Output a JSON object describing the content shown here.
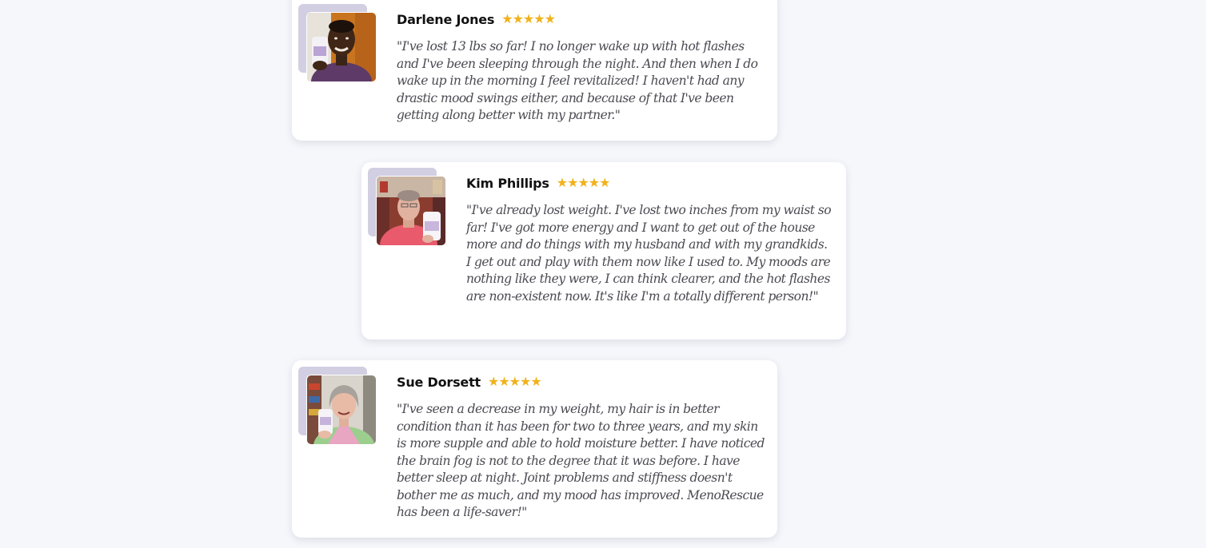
{
  "testimonials": [
    {
      "name": "Darlene Jones",
      "stars": "★★★★★",
      "rating": 5,
      "quote": "\"I've lost 13 lbs so far! I no longer wake up with hot flashes and I've been sleeping through the night. And then when I do wake up in the morning I feel revitalized! I haven't had any drastic mood swings either, and because of that I've been getting along better with my partner.\""
    },
    {
      "name": "Kim Phillips",
      "stars": "★★★★★",
      "rating": 5,
      "quote": "\"I've already lost weight. I've lost two inches from my waist so far! I've got more energy and I want to get out of the house more and do things with my husband and with my grandkids. I get out and play with them now like I used to. My moods are nothing like they were, I can think clearer, and the hot flashes are non-existent now. It's like I'm a totally different person!\""
    },
    {
      "name": "Sue Dorsett",
      "stars": "★★★★★",
      "rating": 5,
      "quote": "\"I've seen a decrease in my weight, my hair is in better condition than it has been for two to three years, and my skin is more supple and able to hold moisture better. I have noticed the brain fog is not to the degree that it was before. I have better sleep at night. Joint problems and stiffness doesn't bother me as much, and my mood has improved. MenoRescue has been a life-saver!\""
    }
  ],
  "colors": {
    "page_background": "#f5f7fb",
    "card_background": "#ffffff",
    "avatar_accent": "#d2cfe2",
    "star": "#f0b21c",
    "name_text": "#111111",
    "quote_text": "#4a4a52"
  }
}
